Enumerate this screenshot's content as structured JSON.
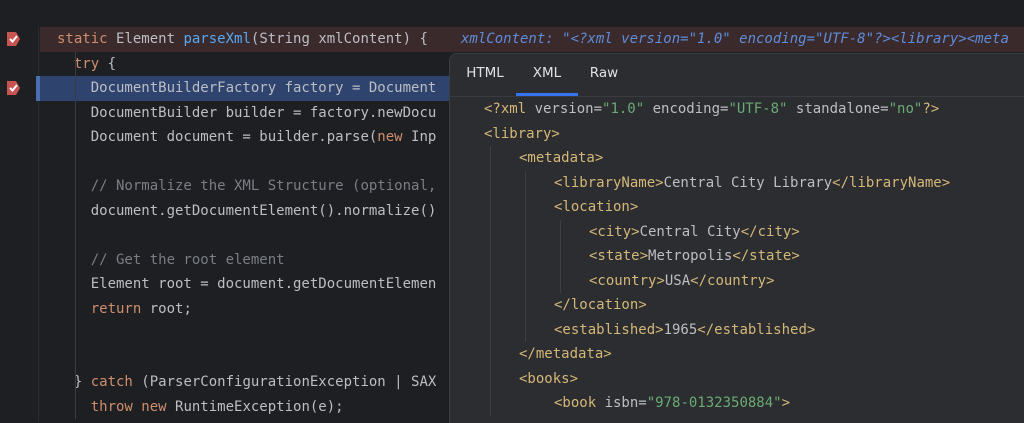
{
  "editor": {
    "lines": [
      {
        "parts": [
          {
            "t": "static ",
            "c": "kw"
          },
          {
            "t": "Element ",
            "c": ""
          },
          {
            "t": "parseXml",
            "c": "fn"
          },
          {
            "t": "(String xmlContent) {",
            "c": ""
          }
        ],
        "indent": 1,
        "hl": "bp",
        "inlay": "xmlContent: \"<?xml version=\"1.0\" encoding=\"UTF-8\"?><library><meta"
      },
      {
        "parts": [
          {
            "t": "try ",
            "c": "kw"
          },
          {
            "t": "{",
            "c": ""
          }
        ],
        "indent": 2
      },
      {
        "parts": [
          {
            "t": "DocumentBuilderFactory factory = Document",
            "c": ""
          }
        ],
        "indent": 3,
        "hl": "exec"
      },
      {
        "parts": [
          {
            "t": "DocumentBuilder builder = factory.newDocu",
            "c": ""
          }
        ],
        "indent": 3
      },
      {
        "parts": [
          {
            "t": "Document document = builder.parse(",
            "c": ""
          },
          {
            "t": "new ",
            "c": "kw"
          },
          {
            "t": "Inp",
            "c": ""
          }
        ],
        "indent": 3
      },
      {
        "parts": [],
        "indent": 3
      },
      {
        "parts": [
          {
            "t": "// Normalize the XML Structure (optional,",
            "c": "cm"
          }
        ],
        "indent": 3
      },
      {
        "parts": [
          {
            "t": "document.getDocumentElement().normalize()",
            "c": ""
          }
        ],
        "indent": 3
      },
      {
        "parts": [],
        "indent": 3
      },
      {
        "parts": [
          {
            "t": "// Get the root element",
            "c": "cm"
          }
        ],
        "indent": 3
      },
      {
        "parts": [
          {
            "t": "Element root = document.getDocumentElemen",
            "c": ""
          }
        ],
        "indent": 3
      },
      {
        "parts": [
          {
            "t": "return ",
            "c": "kw"
          },
          {
            "t": "root;",
            "c": ""
          }
        ],
        "indent": 3
      },
      {
        "parts": [],
        "indent": 3
      },
      {
        "parts": [],
        "indent": 3
      },
      {
        "parts": [
          {
            "t": "} ",
            "c": ""
          },
          {
            "t": "catch ",
            "c": "kw"
          },
          {
            "t": "(ParserConfigurationException | SAX",
            "c": ""
          }
        ],
        "indent": 2
      },
      {
        "parts": [
          {
            "t": "throw ",
            "c": "kw"
          },
          {
            "t": "new ",
            "c": "kw"
          },
          {
            "t": "RuntimeException(e);",
            "c": ""
          }
        ],
        "indent": 3
      }
    ]
  },
  "popup": {
    "tabs": [
      {
        "label": "HTML",
        "active": false
      },
      {
        "label": "XML",
        "active": true
      },
      {
        "label": "Raw",
        "active": false
      }
    ],
    "xml_lines": [
      {
        "indent": 0,
        "parts": [
          {
            "t": "<?xml ",
            "c": ""
          },
          {
            "t": "version=",
            "c": "attr"
          },
          {
            "t": "\"1.0\" ",
            "c": "aval"
          },
          {
            "t": "encoding=",
            "c": "attr"
          },
          {
            "t": "\"UTF-8\" ",
            "c": "aval"
          },
          {
            "t": "standalone=",
            "c": "attr"
          },
          {
            "t": "\"no\"",
            "c": "aval"
          },
          {
            "t": "?>",
            "c": ""
          }
        ]
      },
      {
        "indent": 0,
        "parts": [
          {
            "t": "<library>",
            "c": ""
          }
        ]
      },
      {
        "indent": 1,
        "parts": [
          {
            "t": "<metadata>",
            "c": ""
          }
        ]
      },
      {
        "indent": 2,
        "parts": [
          {
            "t": "<libraryName>",
            "c": ""
          },
          {
            "t": "Central City Library",
            "c": "txt"
          },
          {
            "t": "</libraryName>",
            "c": ""
          }
        ]
      },
      {
        "indent": 2,
        "parts": [
          {
            "t": "<location>",
            "c": ""
          }
        ]
      },
      {
        "indent": 3,
        "parts": [
          {
            "t": "<city>",
            "c": ""
          },
          {
            "t": "Central City",
            "c": "txt"
          },
          {
            "t": "</city>",
            "c": ""
          }
        ]
      },
      {
        "indent": 3,
        "parts": [
          {
            "t": "<state>",
            "c": ""
          },
          {
            "t": "Metropolis",
            "c": "txt"
          },
          {
            "t": "</state>",
            "c": ""
          }
        ]
      },
      {
        "indent": 3,
        "parts": [
          {
            "t": "<country>",
            "c": ""
          },
          {
            "t": "USA",
            "c": "txt"
          },
          {
            "t": "</country>",
            "c": ""
          }
        ]
      },
      {
        "indent": 2,
        "parts": [
          {
            "t": "</location>",
            "c": ""
          }
        ]
      },
      {
        "indent": 2,
        "parts": [
          {
            "t": "<established>",
            "c": ""
          },
          {
            "t": "1965",
            "c": "txt"
          },
          {
            "t": "</established>",
            "c": ""
          }
        ]
      },
      {
        "indent": 1,
        "parts": [
          {
            "t": "</metadata>",
            "c": ""
          }
        ]
      },
      {
        "indent": 1,
        "parts": [
          {
            "t": "<books>",
            "c": ""
          }
        ]
      },
      {
        "indent": 2,
        "parts": [
          {
            "t": "<book ",
            "c": ""
          },
          {
            "t": "isbn=",
            "c": "attr"
          },
          {
            "t": "\"978-0132350884\"",
            "c": "aval"
          },
          {
            "t": ">",
            "c": ""
          }
        ]
      }
    ]
  },
  "icons": {
    "breakpoint": "breakpoint-icon"
  },
  "colors": {
    "bg": "#1e1f22",
    "keyword": "#cf8e6d",
    "function": "#56a8f5",
    "comment": "#7a7e85",
    "xml_tag": "#d5b778",
    "xml_value": "#6aab73",
    "tab_underline": "#3574f0"
  }
}
